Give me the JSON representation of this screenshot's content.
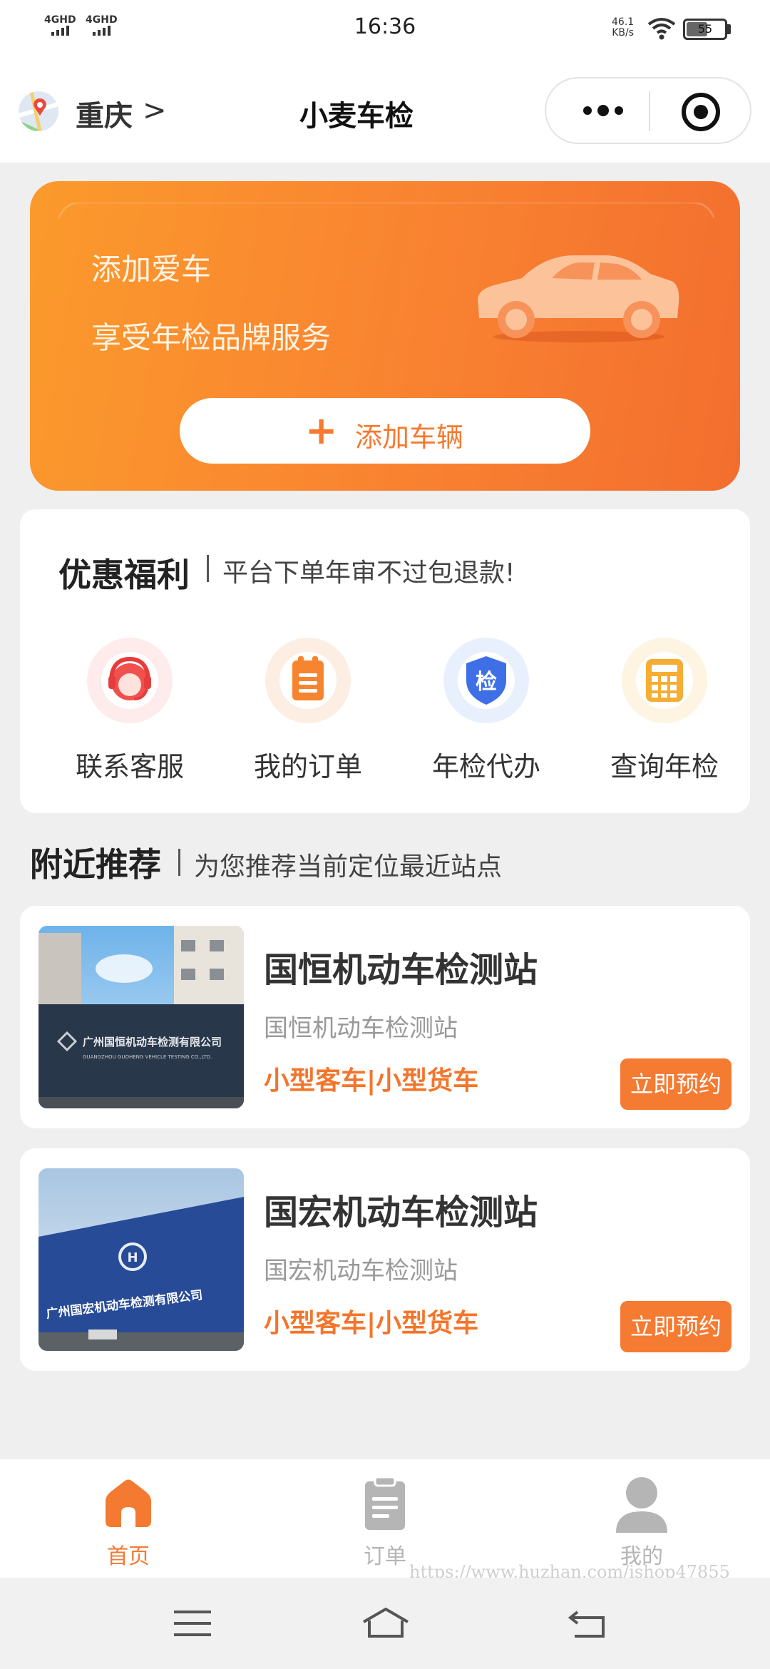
{
  "status_bar": {
    "signal_1": "4GHD",
    "signal_2": "4GHD",
    "time": "16:36",
    "speed_value": "46.1",
    "speed_unit": "KB/s",
    "battery": "55",
    "battery_level": 0.55
  },
  "nav": {
    "city": "重庆",
    "city_chevron": ">",
    "title": "小麦车检",
    "more_icon": "more-dots-icon",
    "close_icon": "target-icon"
  },
  "banner": {
    "line1": "添加爱车",
    "line2": "享受年检品牌服务",
    "add_plus": "+",
    "add_label": "添加车辆"
  },
  "benefits": {
    "title": "优惠福利",
    "subtitle": "平台下单年审不过包退款!",
    "items": [
      {
        "label": "联系客服",
        "icon": "headset-icon"
      },
      {
        "label": "我的订单",
        "icon": "clipboard-icon"
      },
      {
        "label": "年检代办",
        "icon": "shield-icon",
        "badge": "检"
      },
      {
        "label": "查询年检",
        "icon": "calculator-icon"
      }
    ]
  },
  "nearby": {
    "title": "附近推荐",
    "subtitle": "为您推荐当前定位最近站点",
    "stations": [
      {
        "name": "国恒机动车检测站",
        "subtitle": "国恒机动车检测站",
        "tags": "小型客车|小型货车",
        "book_label": "立即预约",
        "photo_sign": "广州国恒机动车检测有限公司",
        "photo_sign_en": "GUANGZHOU GUOHENG VEHICLE TESTING CO.,LTD."
      },
      {
        "name": "国宏机动车检测站",
        "subtitle": "国宏机动车检测站",
        "tags": "小型客车|小型货车",
        "book_label": "立即预约",
        "photo_sign": "广州国宏机动车检测有限公司"
      }
    ]
  },
  "tabbar": {
    "tabs": [
      {
        "label": "首页",
        "icon": "home-icon",
        "active": true
      },
      {
        "label": "订单",
        "icon": "order-icon",
        "active": false
      },
      {
        "label": "我的",
        "icon": "user-icon",
        "active": false
      }
    ]
  },
  "watermark": "https://www.huzhan.com/ishop47855",
  "colors": {
    "accent": "#f7792f",
    "tab_active": "#f47a32",
    "tab_inactive": "#b5b5b5"
  }
}
